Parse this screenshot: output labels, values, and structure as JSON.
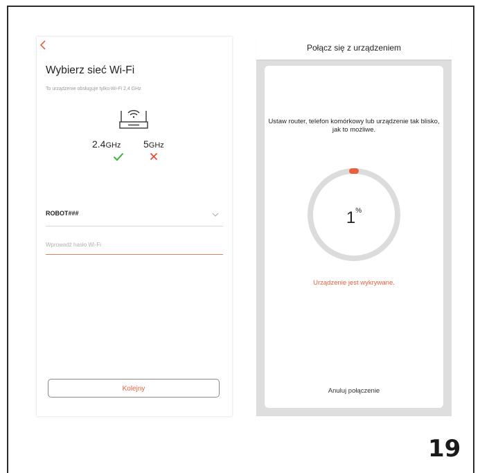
{
  "wifi_screen": {
    "title": "Wybierz sieć Wi-Fi",
    "subtitle": "To urządzenie obsługuje tylko Wi-Fi 2,4 GHz",
    "band_24": {
      "value": "2.4",
      "unit": "GHz",
      "supported": true
    },
    "band_5": {
      "value": "5",
      "unit": "GHz",
      "supported": false
    },
    "ssid": "ROBOT###",
    "password": {
      "value": "",
      "placeholder": "Wprowadź hasło Wi-Fi"
    },
    "next_label": "Kolejny",
    "icons": [
      "back-icon",
      "router-wifi-icon",
      "check-icon",
      "cross-icon",
      "chevron-down-icon"
    ]
  },
  "connect_screen": {
    "title": "Połącz się z urządzeniem",
    "instruction": "Ustaw router, telefon komórkowy lub urządzenie tak blisko, jak to możliwe.",
    "progress": {
      "value": "1",
      "unit": "%"
    },
    "status": "Urządzenie jest wykrywane.",
    "cancel_label": "Anuluj połączenie"
  },
  "page_number": "19",
  "colors": {
    "accent": "#e8603f",
    "success": "#3cb33c",
    "error": "#e84a3a",
    "ring_track": "#dcdcdc",
    "background_gray": "#dedede"
  }
}
